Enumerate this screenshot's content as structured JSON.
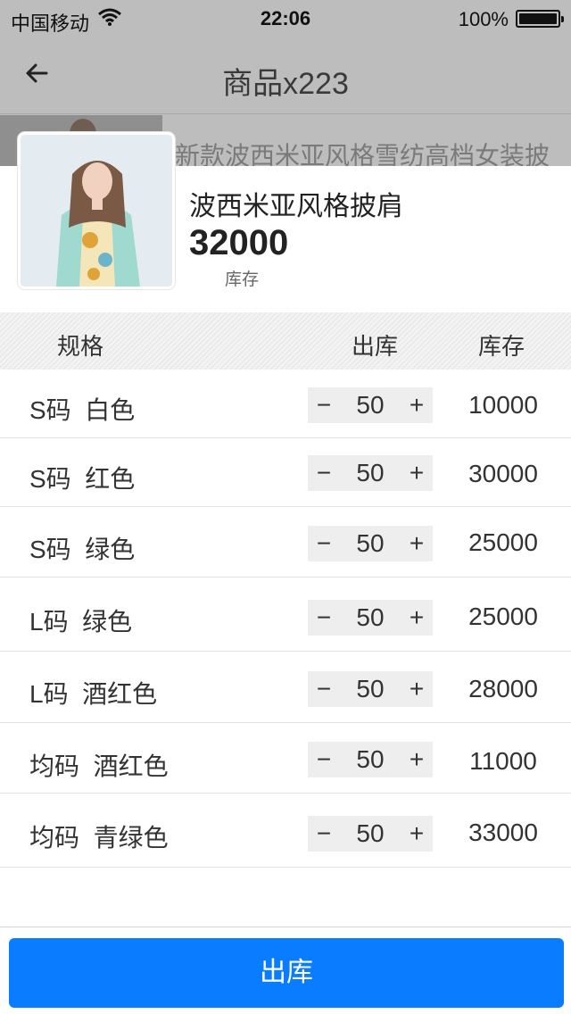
{
  "status_bar": {
    "carrier": "中国移动",
    "time": "22:06",
    "battery": "100%"
  },
  "nav": {
    "title": "商品x223"
  },
  "background_product": {
    "name": "新款波西米亚风格雪纺高档女装披"
  },
  "product": {
    "name": "波西米亚风格披肩",
    "stock": "32000",
    "stock_label": "库存"
  },
  "table": {
    "headers": {
      "spec": "规格",
      "out": "出库",
      "stock": "库存"
    },
    "rows": [
      {
        "size": "S码",
        "color": "白色",
        "qty": "50",
        "stock": "10000"
      },
      {
        "size": "S码",
        "color": "红色",
        "qty": "50",
        "stock": "30000"
      },
      {
        "size": "S码",
        "color": "绿色",
        "qty": "50",
        "stock": "25000"
      },
      {
        "size": "L码",
        "color": "绿色",
        "qty": "50",
        "stock": "25000"
      },
      {
        "size": "L码",
        "color": "酒红色",
        "qty": "50",
        "stock": "28000"
      },
      {
        "size": "均码",
        "color": "酒红色",
        "qty": "50",
        "stock": "11000"
      },
      {
        "size": "均码",
        "color": "青绿色",
        "qty": "50",
        "stock": "33000"
      }
    ]
  },
  "stepper": {
    "minus": "−",
    "plus": "+"
  },
  "submit": {
    "label": "出库"
  },
  "colors": {
    "accent": "#0a7cff",
    "overlay": "#bdbdbd"
  }
}
